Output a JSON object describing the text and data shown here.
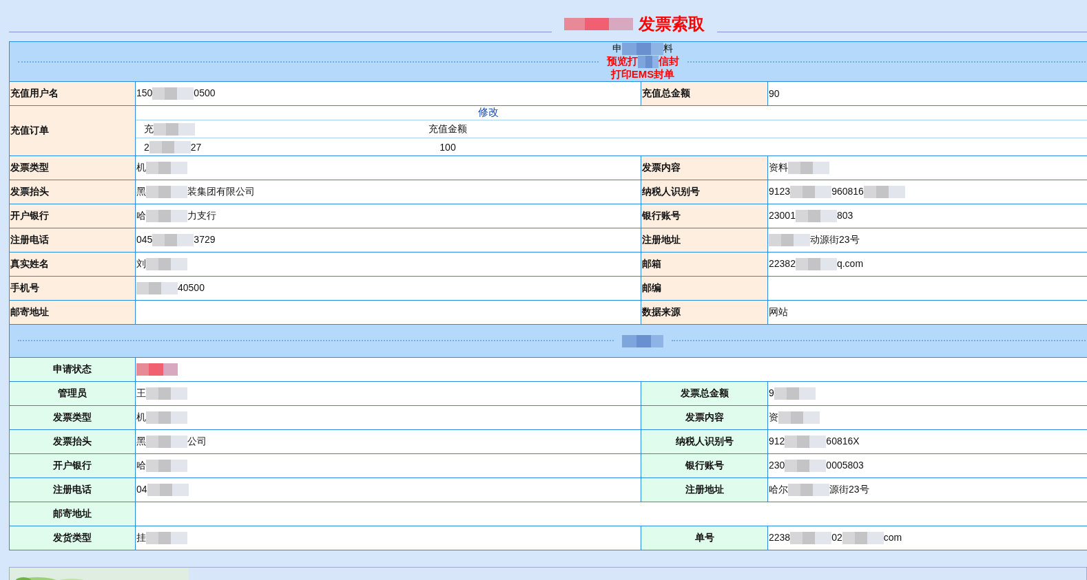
{
  "title": {
    "prefix_redacted": true,
    "text": "发票索取"
  },
  "sections": [
    {
      "kind": "request",
      "heading": [
        {
          "kind": "text",
          "text": "申"
        },
        {
          "kind": "blur"
        },
        {
          "kind": "text",
          "text": "料"
        }
      ],
      "links": [
        [
          {
            "kind": "text",
            "text": "预览打"
          },
          {
            "kind": "blur"
          },
          {
            "kind": "text",
            "text": "信封"
          }
        ],
        [
          {
            "kind": "text",
            "text": "打印EMS封单"
          }
        ]
      ],
      "rows": [
        {
          "kind": "pair",
          "left": {
            "label": "充值用户名",
            "value": [
              {
                "kind": "text",
                "text": "150"
              },
              {
                "kind": "blur"
              },
              {
                "kind": "text",
                "text": "0500"
              }
            ]
          },
          "right": {
            "label": "充值总金额",
            "value": [
              {
                "kind": "text",
                "text": "90"
              }
            ]
          }
        },
        {
          "kind": "order",
          "label": "充值订单",
          "edit_link": "修改",
          "columns": [
            [
              {
                "kind": "text",
                "text": "充"
              },
              {
                "kind": "blur"
              }
            ],
            [
              {
                "kind": "text",
                "text": "充值金额"
              }
            ]
          ],
          "cells": [
            [
              {
                "kind": "text",
                "text": "2"
              },
              {
                "kind": "blur"
              },
              {
                "kind": "text",
                "text": "27"
              }
            ],
            [
              {
                "kind": "text",
                "text": "100"
              }
            ]
          ]
        },
        {
          "kind": "pair",
          "left": {
            "label": "发票类型",
            "value": [
              {
                "kind": "text",
                "text": "机"
              },
              {
                "kind": "blur"
              }
            ]
          },
          "right": {
            "label": "发票内容",
            "value": [
              {
                "kind": "text",
                "text": "资料"
              },
              {
                "kind": "blur"
              }
            ]
          }
        },
        {
          "kind": "pair",
          "left": {
            "label": "发票抬头",
            "value": [
              {
                "kind": "text",
                "text": "黑"
              },
              {
                "kind": "blur"
              },
              {
                "kind": "text",
                "text": "装集团有限公司"
              }
            ]
          },
          "right": {
            "label": "纳税人识别号",
            "value": [
              {
                "kind": "text",
                "text": "9123"
              },
              {
                "kind": "blur"
              },
              {
                "kind": "text",
                "text": "960816"
              },
              {
                "kind": "blur"
              }
            ]
          }
        },
        {
          "kind": "pair",
          "left": {
            "label": "开户银行",
            "value": [
              {
                "kind": "text",
                "text": "哈"
              },
              {
                "kind": "blur"
              },
              {
                "kind": "text",
                "text": "力支行"
              }
            ]
          },
          "right": {
            "label": "银行账号",
            "value": [
              {
                "kind": "text",
                "text": "23001"
              },
              {
                "kind": "blur"
              },
              {
                "kind": "text",
                "text": "803"
              }
            ]
          }
        },
        {
          "kind": "pair",
          "left": {
            "label": "注册电话",
            "value": [
              {
                "kind": "text",
                "text": "045"
              },
              {
                "kind": "blur"
              },
              {
                "kind": "text",
                "text": "3729"
              }
            ]
          },
          "right": {
            "label": "注册地址",
            "value": [
              {
                "kind": "blur"
              },
              {
                "kind": "text",
                "text": "动源街23号"
              }
            ]
          }
        },
        {
          "kind": "pair",
          "left": {
            "label": "真实姓名",
            "value": [
              {
                "kind": "text",
                "text": "刘"
              },
              {
                "kind": "blur"
              }
            ]
          },
          "right": {
            "label": "邮箱",
            "value": [
              {
                "kind": "text",
                "text": "22382"
              },
              {
                "kind": "blur"
              },
              {
                "kind": "text",
                "text": "q.com"
              }
            ]
          }
        },
        {
          "kind": "pair",
          "left": {
            "label": "手机号",
            "value": [
              {
                "kind": "blur"
              },
              {
                "kind": "text",
                "text": "40500"
              }
            ]
          },
          "right": {
            "label": "邮编"
          }
        },
        {
          "kind": "pair",
          "left": {
            "label": "邮寄地址"
          },
          "right": {
            "label": "数据来源",
            "value": [
              {
                "kind": "text",
                "text": "网站"
              }
            ]
          }
        }
      ]
    },
    {
      "kind": "result",
      "heading": [
        {
          "kind": "blur"
        }
      ],
      "rows": [
        {
          "kind": "single",
          "label": "申请状态",
          "alert": true,
          "value": [
            {
              "kind": "blur"
            }
          ]
        },
        {
          "kind": "pair",
          "left": {
            "label": "管理员",
            "value": [
              {
                "kind": "text",
                "text": "王"
              },
              {
                "kind": "blur"
              }
            ]
          },
          "right": {
            "label": "发票总金额",
            "value": [
              {
                "kind": "text",
                "text": "9"
              },
              {
                "kind": "blur"
              }
            ]
          }
        },
        {
          "kind": "pair",
          "left": {
            "label": "发票类型",
            "value": [
              {
                "kind": "text",
                "text": "机"
              },
              {
                "kind": "blur"
              }
            ]
          },
          "right": {
            "label": "发票内容",
            "value": [
              {
                "kind": "text",
                "text": "资"
              },
              {
                "kind": "blur"
              }
            ]
          }
        },
        {
          "kind": "pair",
          "left": {
            "label": "发票抬头",
            "value": [
              {
                "kind": "text",
                "text": "黑"
              },
              {
                "kind": "blur"
              },
              {
                "kind": "text",
                "text": "公司"
              }
            ]
          },
          "right": {
            "label": "纳税人识别号",
            "value": [
              {
                "kind": "text",
                "text": "912"
              },
              {
                "kind": "blur"
              },
              {
                "kind": "text",
                "text": "60816X"
              }
            ]
          }
        },
        {
          "kind": "pair",
          "left": {
            "label": "开户银行",
            "value": [
              {
                "kind": "text",
                "text": "哈"
              },
              {
                "kind": "blur"
              }
            ]
          },
          "right": {
            "label": "银行账号",
            "value": [
              {
                "kind": "text",
                "text": "230"
              },
              {
                "kind": "blur"
              },
              {
                "kind": "text",
                "text": "0005803"
              }
            ]
          }
        },
        {
          "kind": "pair",
          "left": {
            "label": "注册电话",
            "value": [
              {
                "kind": "text",
                "text": "04"
              },
              {
                "kind": "blur"
              }
            ]
          },
          "right": {
            "label": "注册地址",
            "value": [
              {
                "kind": "text",
                "text": "哈尔"
              },
              {
                "kind": "blur"
              },
              {
                "kind": "text",
                "text": "源街23号"
              }
            ]
          }
        },
        {
          "kind": "single",
          "label": "邮寄地址"
        },
        {
          "kind": "pair",
          "left": {
            "label": "发货类型",
            "value": [
              {
                "kind": "text",
                "text": "挂"
              },
              {
                "kind": "blur"
              }
            ]
          },
          "right": {
            "label": "单号",
            "value": [
              {
                "kind": "text",
                "text": "2238"
              },
              {
                "kind": "blur"
              },
              {
                "kind": "text",
                "text": "02"
              },
              {
                "kind": "blur"
              },
              {
                "kind": "text",
                "text": "com"
              }
            ]
          }
        }
      ]
    }
  ]
}
